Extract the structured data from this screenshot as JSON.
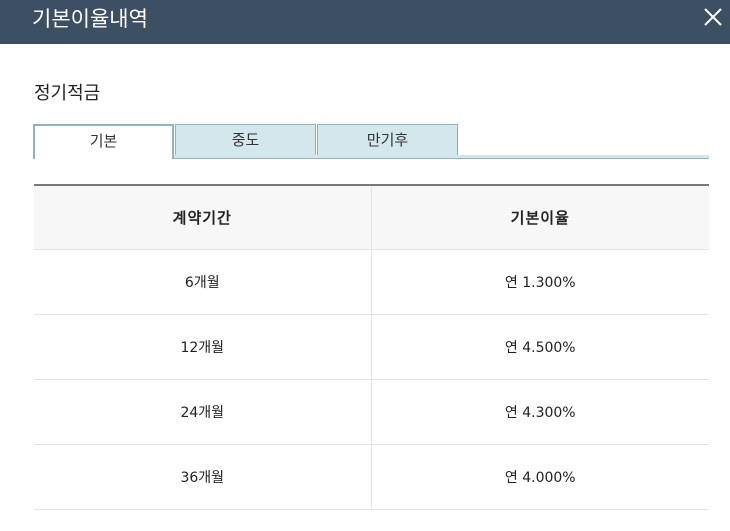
{
  "dialog": {
    "title": "기본이율내역",
    "close_icon": "close-icon"
  },
  "section": {
    "title": "정기적금"
  },
  "tabs": [
    {
      "label": "기본",
      "active": true
    },
    {
      "label": "중도",
      "active": false
    },
    {
      "label": "만기후",
      "active": false
    }
  ],
  "table": {
    "headers": [
      "계약기간",
      "기본이율"
    ],
    "rows": [
      {
        "period": "6개월",
        "rate": "연 1.300%"
      },
      {
        "period": "12개월",
        "rate": "연 4.500%"
      },
      {
        "period": "24개월",
        "rate": "연 4.300%"
      },
      {
        "period": "36개월",
        "rate": "연 4.000%"
      }
    ]
  },
  "colors": {
    "titlebar": "#3d4f63",
    "tab_inactive": "#d3e7ec",
    "tab_border": "#8fb3bf",
    "header_bg": "#f7f7f7"
  }
}
